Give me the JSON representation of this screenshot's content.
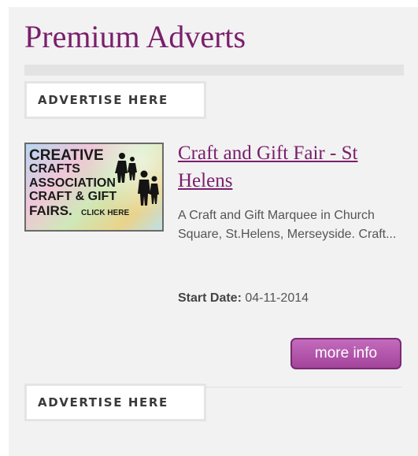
{
  "widget": {
    "title": "Premium Adverts",
    "advertise_top": "ADVERTISE HERE",
    "advertise_bottom": "ADVERTISE HERE"
  },
  "ad": {
    "title": "Craft and Gift Fair - St Helens",
    "description": "A Craft and Gift Marquee in Church Square, St.Helens, Merseyside. Craft...",
    "start_label": "Start Date:",
    "start_date": "04-11-2014",
    "button_label": "more info",
    "thumbnail": {
      "lines": [
        "CREATIVE",
        "CRAFTS",
        "ASSOCIATION",
        "CRAFT & GIFT",
        "FAIRS.",
        "CLICK HERE"
      ]
    }
  },
  "colors": {
    "accent": "#7a1f6b",
    "button": "#b355ab",
    "panel_bg": "#f2f2f2"
  }
}
